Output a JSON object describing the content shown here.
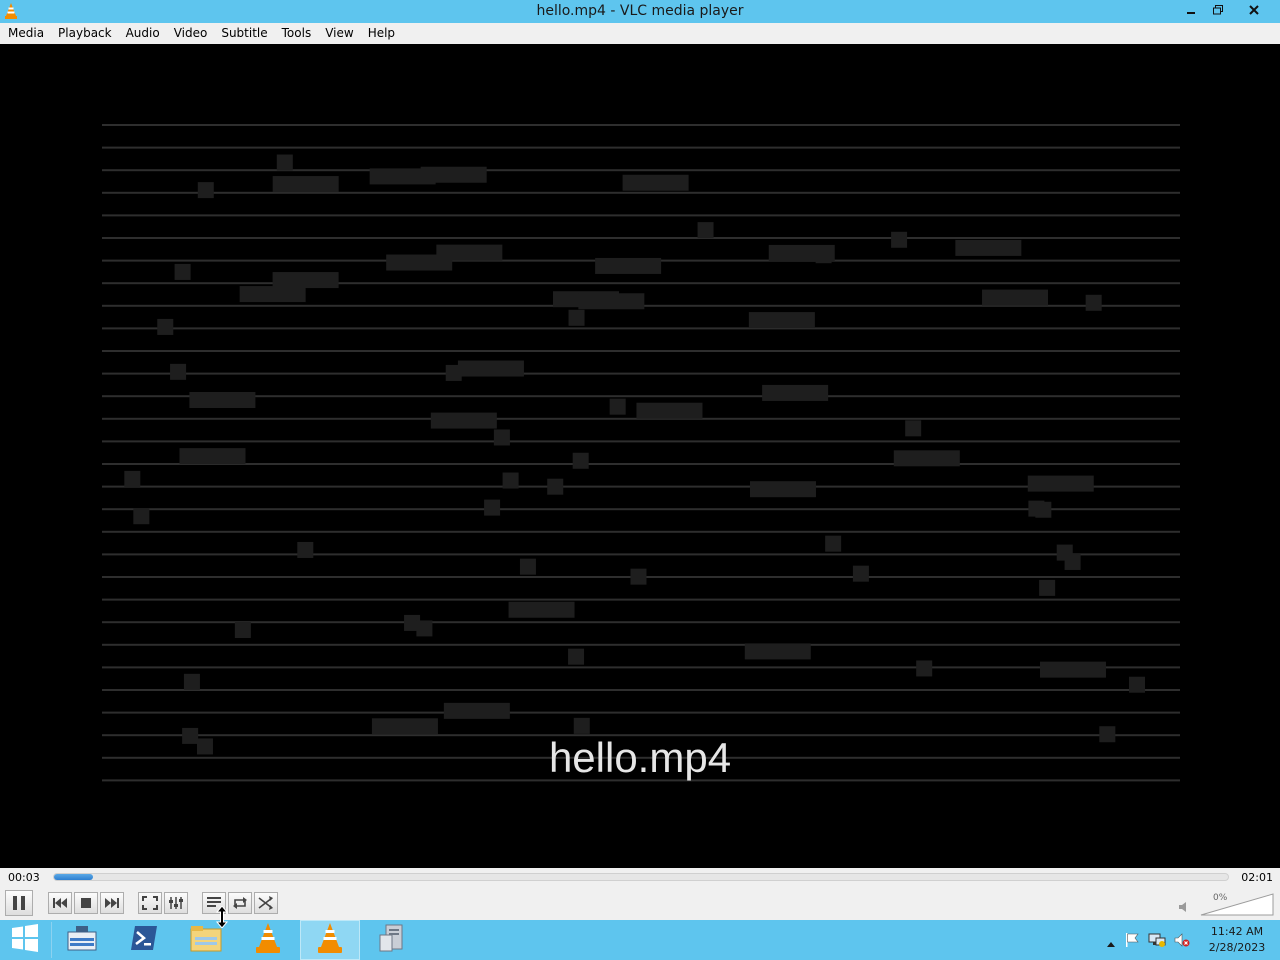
{
  "window": {
    "title": "hello.mp4 - VLC media player"
  },
  "menu": [
    "Media",
    "Playback",
    "Audio",
    "Video",
    "Subtitle",
    "Tools",
    "View",
    "Help"
  ],
  "video": {
    "overlay_text": "hello.mp4"
  },
  "seek": {
    "elapsed": "00:03",
    "total": "02:01",
    "progress": 0.033
  },
  "controls": {
    "play_state": "pause-icon",
    "buttons": [
      "prev-icon",
      "stop-icon",
      "next-icon",
      "fullscreen-icon",
      "extended-settings-icon",
      "playlist-icon",
      "loop-icon",
      "random-icon"
    ]
  },
  "volume": {
    "label": "0%",
    "level": 0
  },
  "taskbar": {
    "apps": [
      "windows-start-icon",
      "server-manager-icon",
      "powershell-icon",
      "file-explorer-icon",
      "vlc-icon",
      "vlc-icon",
      "system-tool-icon"
    ],
    "clock_time": "11:42 AM",
    "clock_date": "2/28/2023"
  },
  "colors": {
    "titlebar": "#5ec5ee",
    "taskbar": "#5ec5ee",
    "progress": "#2d7fd0",
    "vlc_orange": "#f28c00"
  }
}
